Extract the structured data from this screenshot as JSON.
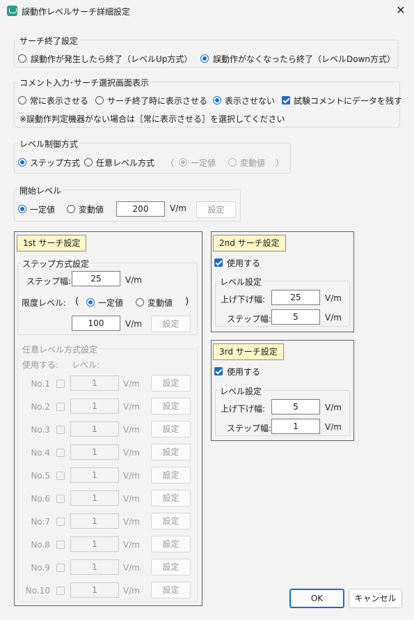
{
  "window": {
    "title": "誤動作レベルサーチ詳細設定",
    "icon": "app-icon",
    "close_glyph": "✕"
  },
  "search_end": {
    "title": "サーチ終了設定",
    "options": [
      {
        "label": "誤動作が発生したら終了（レベルUp方式）",
        "selected": false
      },
      {
        "label": "誤動作がなくなったら終了（レベルDown方式）",
        "selected": true
      }
    ]
  },
  "comment": {
    "title": "コメント入力･サーチ選択画面表示",
    "options": [
      {
        "label": "常に表示させる",
        "selected": false
      },
      {
        "label": "サーチ終了時に表示させる",
        "selected": false
      },
      {
        "label": "表示させない",
        "selected": true
      }
    ],
    "keep_data_label": "試験コメントにデータを残す",
    "keep_data_checked": true,
    "note": "※誤動作判定機器がない場合は［常に表示させる］を選択してください"
  },
  "level_control": {
    "title": "レベル制御方式",
    "options": [
      {
        "label": "ステップ方式",
        "selected": true
      },
      {
        "label": "任意レベル方式",
        "selected": false
      }
    ],
    "paren_open": "（",
    "paren_close": "）",
    "sub_options": [
      {
        "label": "一定値",
        "selected": true,
        "disabled": true
      },
      {
        "label": "変動値",
        "selected": false,
        "disabled": true
      }
    ]
  },
  "start_level": {
    "title": "開始レベル",
    "options": [
      {
        "label": "一定値",
        "selected": true
      },
      {
        "label": "変動値",
        "selected": false
      }
    ],
    "value": "200",
    "unit": "V/m",
    "button": "設定"
  },
  "first_search": {
    "title": "1st サーチ設定",
    "step": {
      "title": "ステップ方式設定",
      "step_width_label": "ステップ幅:",
      "step_width": "25",
      "unit": "V/m",
      "limit_label": "限度レベル:",
      "paren_open": "(",
      "paren_close": ")",
      "limit_options": [
        {
          "label": "一定値",
          "selected": true
        },
        {
          "label": "変動値",
          "selected": false
        }
      ],
      "limit_value": "100",
      "limit_unit": "V/m",
      "button": "設定"
    },
    "arbitrary": {
      "title": "任意レベル方式設定",
      "use_header": "使用する:",
      "level_header": "レベル:",
      "unit": "V/m",
      "button": "設定",
      "rows": [
        {
          "no": "No.1",
          "value": "1"
        },
        {
          "no": "No.2",
          "value": "1"
        },
        {
          "no": "No.3",
          "value": "1"
        },
        {
          "no": "No.4",
          "value": "1"
        },
        {
          "no": "No.5",
          "value": "1"
        },
        {
          "no": "No.6",
          "value": "1"
        },
        {
          "no": "No.7",
          "value": "1"
        },
        {
          "no": "No.8",
          "value": "1"
        },
        {
          "no": "No.9",
          "value": "1"
        },
        {
          "no": "No.10",
          "value": "1"
        }
      ]
    }
  },
  "second_search": {
    "title": "2nd サーチ設定",
    "use_label": "使用する",
    "use_checked": true,
    "level_title": "レベル設定",
    "updown_label": "上げ下げ幅:",
    "updown_value": "25",
    "step_label": "ステップ幅:",
    "step_value": "5",
    "unit": "V/m"
  },
  "third_search": {
    "title": "3rd サーチ設定",
    "use_label": "使用する",
    "use_checked": true,
    "level_title": "レベル設定",
    "updown_label": "上げ下げ幅:",
    "updown_value": "5",
    "step_label": "ステップ幅:",
    "step_value": "1",
    "unit": "V/m"
  },
  "footer": {
    "ok": "OK",
    "cancel": "キャンセル"
  }
}
